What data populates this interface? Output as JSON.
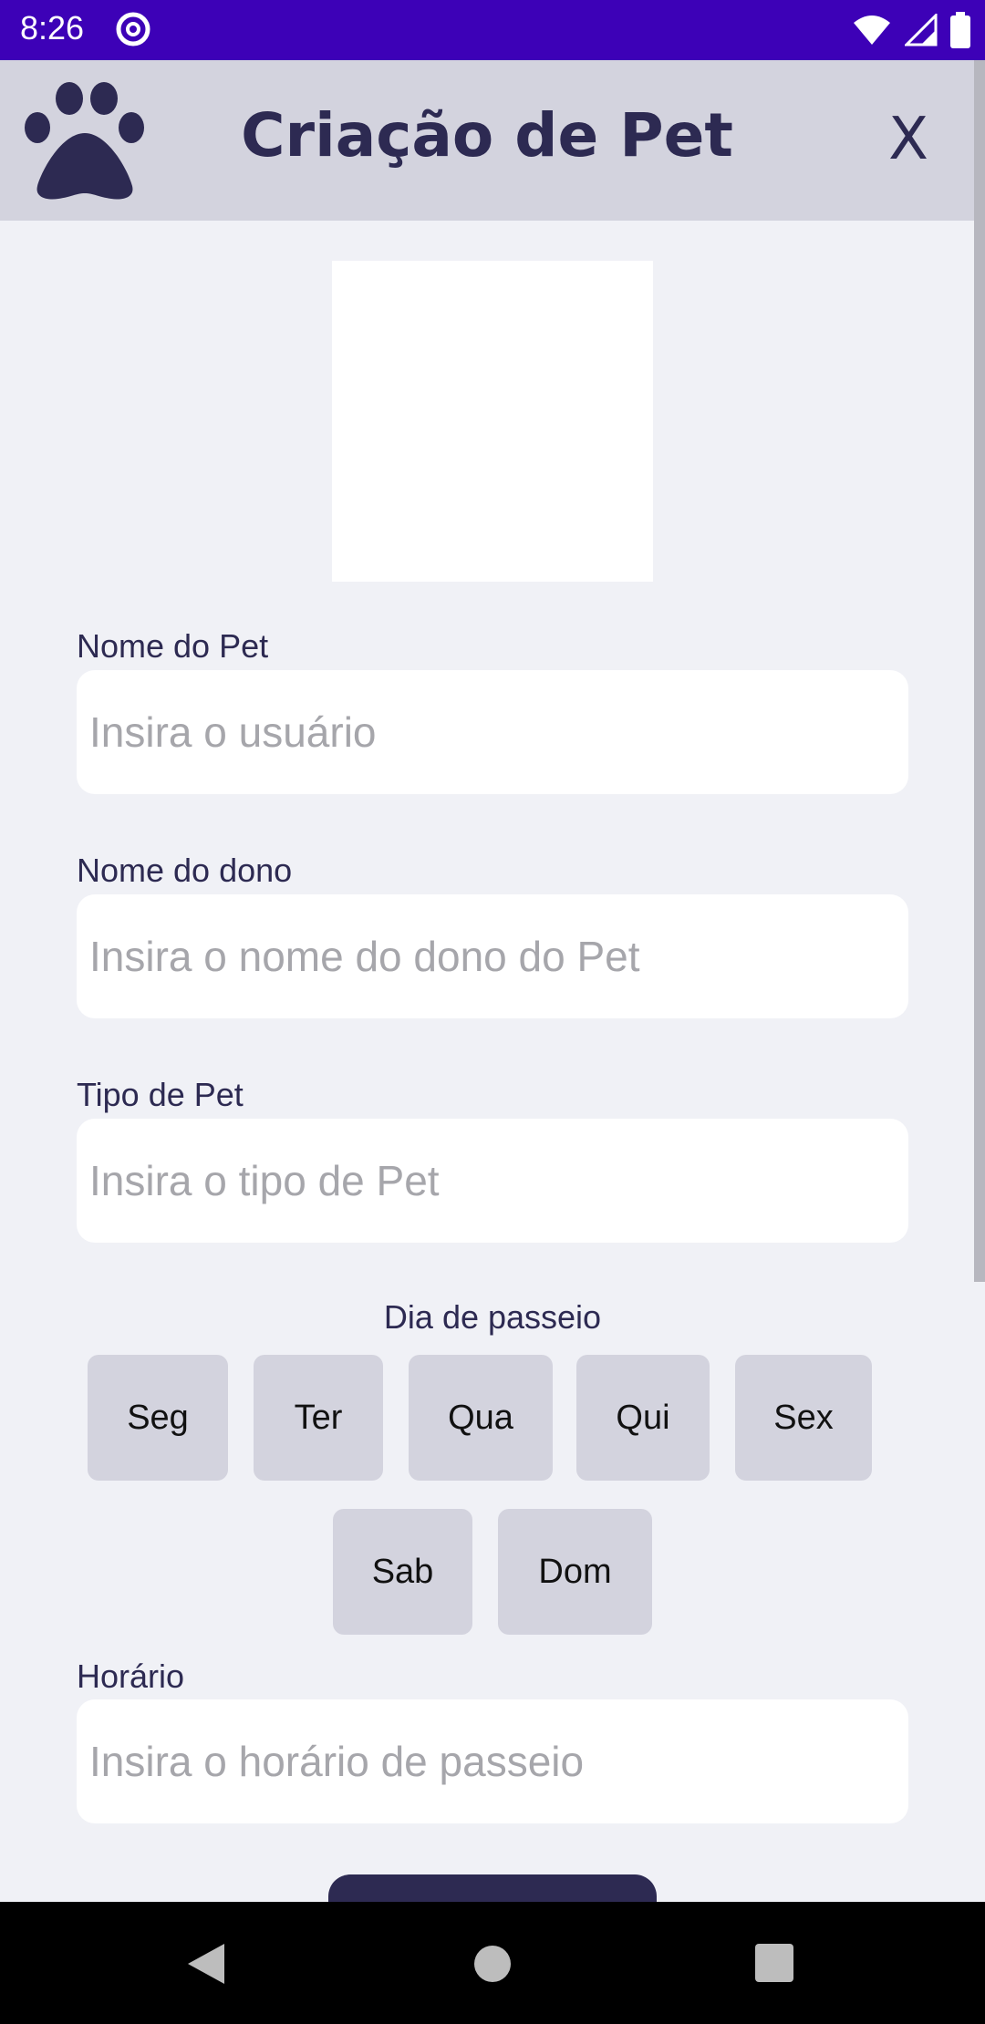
{
  "status": {
    "time": "8:26"
  },
  "appbar": {
    "title": "Criação de Pet",
    "close_label": "X"
  },
  "form": {
    "pet_name": {
      "label": "Nome do Pet",
      "placeholder": "Insira o usuário",
      "value": ""
    },
    "owner_name": {
      "label": "Nome do dono",
      "placeholder": "Insira o nome do dono do Pet",
      "value": ""
    },
    "pet_type": {
      "label": "Tipo de Pet",
      "placeholder": "Insira o tipo de Pet",
      "value": ""
    },
    "walk_day": {
      "label": "Dia de passeio",
      "days": [
        "Seg",
        "Ter",
        "Qua",
        "Qui",
        "Sex",
        "Sab",
        "Dom"
      ]
    },
    "time": {
      "label": "Horário",
      "placeholder": "Insira o horário de passeio",
      "value": ""
    }
  },
  "colors": {
    "status_bar": "#3d01b7",
    "app_bar": "#d3d3de",
    "accent": "#2d2a52",
    "background": "#f0f1f6"
  },
  "icons": [
    "paw-icon",
    "wifi-icon",
    "signal-icon",
    "battery-icon",
    "back-icon",
    "home-icon",
    "recents-icon"
  ]
}
